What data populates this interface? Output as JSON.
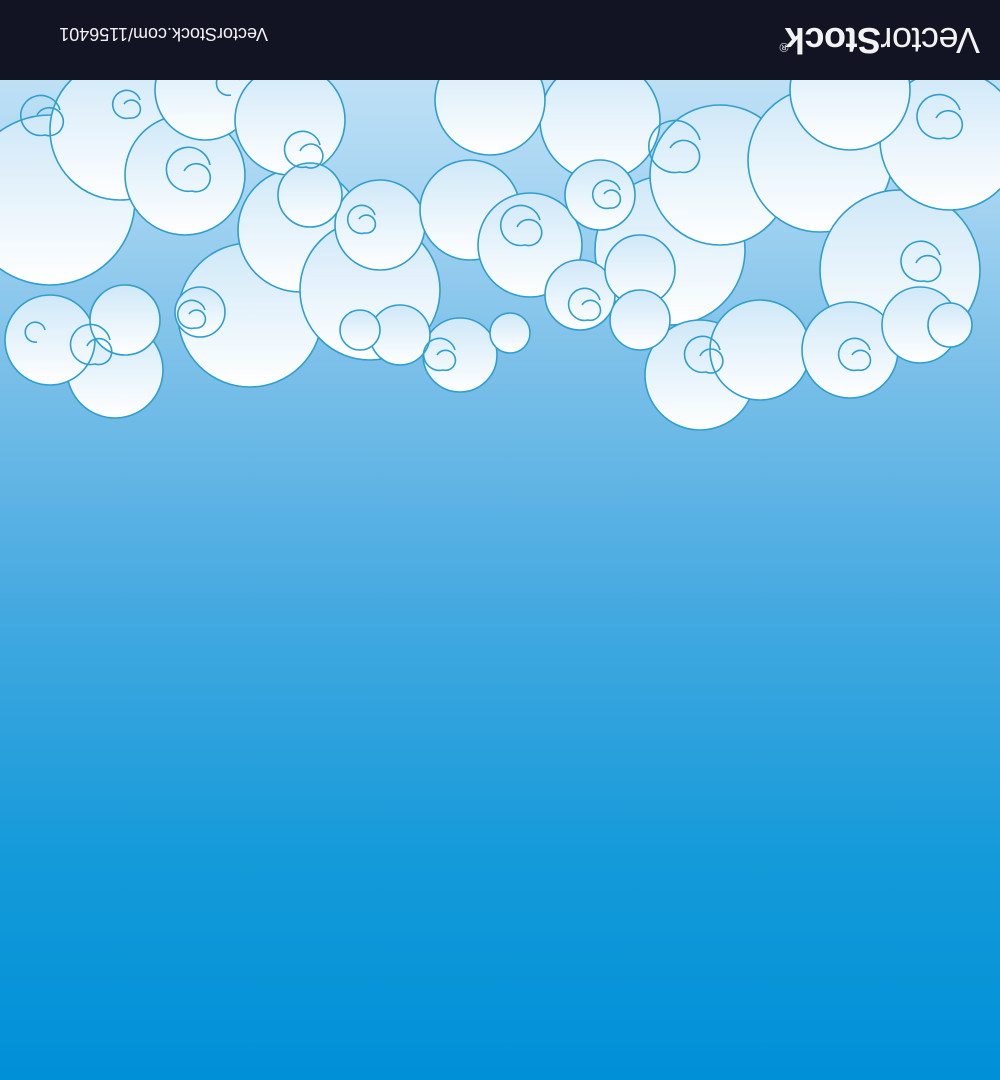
{
  "watermark": {
    "brand_light": "Vector",
    "brand_bold": "Stock",
    "registered": "®",
    "url": "VectorStock.com/1156401"
  },
  "colors": {
    "bar": "#121423",
    "sky_bottom": "#0090d8",
    "cloud_fill": "#ffffff",
    "cloud_stroke": "#2f9fd0"
  }
}
